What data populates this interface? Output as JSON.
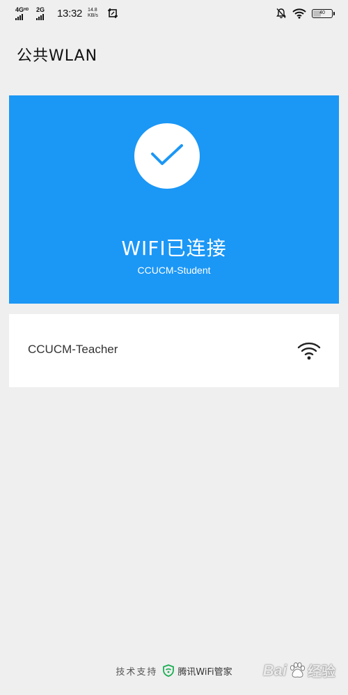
{
  "status_bar": {
    "network1": "4G",
    "network1_sup": "HD",
    "network2": "2G",
    "time": "13:32",
    "speed_value": "14.8",
    "speed_unit": "KB/s",
    "battery": "40"
  },
  "header": {
    "title": "公共WLAN"
  },
  "connected": {
    "status": "WIFI已连接",
    "ssid": "CCUCM-Student"
  },
  "networks": [
    {
      "name": "CCUCM-Teacher",
      "icon": "wifi-signal-icon"
    }
  ],
  "footer": {
    "support_label": "技术支持",
    "brand": "腾讯WiFi管家"
  },
  "watermark": {
    "brand": "Bai",
    "suffix": "经验"
  },
  "colors": {
    "accent": "#1b97f6",
    "card_bg": "#ffffff",
    "page_bg": "#efefef",
    "brand_green": "#1aad52"
  }
}
